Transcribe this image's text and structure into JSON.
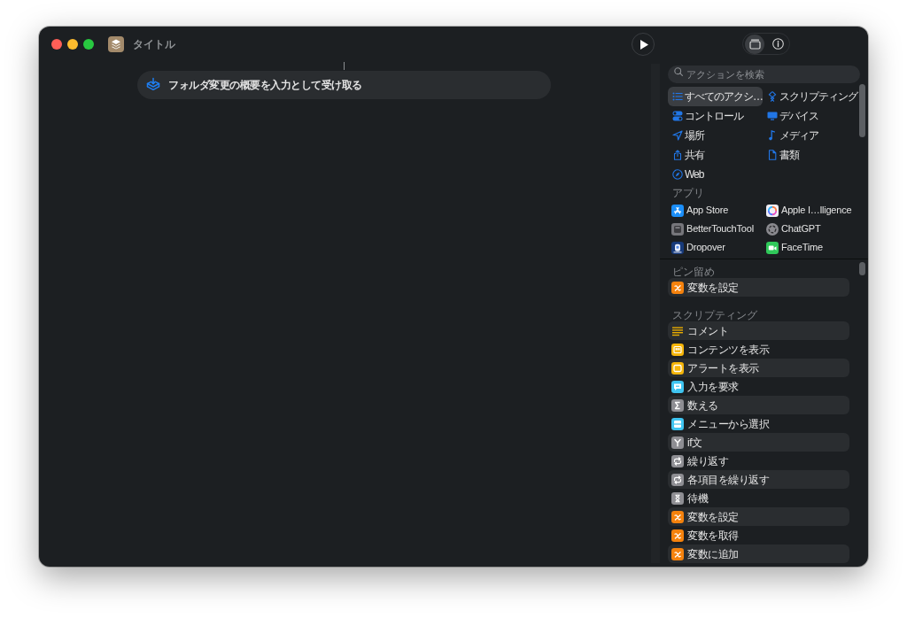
{
  "window": {
    "title": "タイトル"
  },
  "editor": {
    "actions": [
      {
        "text": "フォルダ変更の概要を入力として受け取る"
      }
    ]
  },
  "sidebar": {
    "panel_tabs": [
      {
        "selected": true
      },
      {
        "selected": false
      }
    ],
    "search": {
      "placeholder": "アクションを検索"
    },
    "categories": [
      {
        "label": "すべてのアクシ…",
        "selected": true
      },
      {
        "label": "スクリプティング",
        "selected": false
      },
      {
        "label": "コントロール",
        "selected": false
      },
      {
        "label": "デバイス",
        "selected": false
      },
      {
        "label": "場所",
        "selected": false
      },
      {
        "label": "メディア",
        "selected": false
      },
      {
        "label": "共有",
        "selected": false
      },
      {
        "label": "書類",
        "selected": false
      },
      {
        "label": "Web",
        "selected": false
      }
    ],
    "apps_header": "アプリ",
    "apps": [
      {
        "label": "App Store",
        "selected": false
      },
      {
        "label": "Apple I…lligence",
        "selected": false
      },
      {
        "label": "BetterTouchTool",
        "selected": false
      },
      {
        "label": "ChatGPT",
        "selected": false
      },
      {
        "label": "Dropover",
        "selected": false
      },
      {
        "label": "FaceTime",
        "selected": false
      }
    ],
    "sections": [
      {
        "title": "ピン留め",
        "items": [
          {
            "label": "変数を設定",
            "color": "#f5820d"
          }
        ]
      },
      {
        "title": "スクリプティング",
        "items": [
          {
            "label": "コメント",
            "color": "#e9ad00"
          },
          {
            "label": "コンテンツを表示",
            "color": "#f5b50a"
          },
          {
            "label": "アラートを表示",
            "color": "#f5b50a"
          },
          {
            "label": "入力を要求",
            "color": "#3fc4f0"
          },
          {
            "label": "数える",
            "color": "#8e8e93"
          },
          {
            "label": "メニューから選択",
            "color": "#3fc4f0"
          },
          {
            "label": "if文",
            "color": "#8e8e93"
          },
          {
            "label": "繰り返す",
            "color": "#8e8e93"
          },
          {
            "label": "各項目を繰り返す",
            "color": "#8e8e93"
          },
          {
            "label": "待機",
            "color": "#8e8e93"
          },
          {
            "label": "変数を設定",
            "color": "#f5820d"
          },
          {
            "label": "変数を取得",
            "color": "#f5820d"
          },
          {
            "label": "変数に追加",
            "color": "#f5820d"
          }
        ]
      }
    ]
  }
}
